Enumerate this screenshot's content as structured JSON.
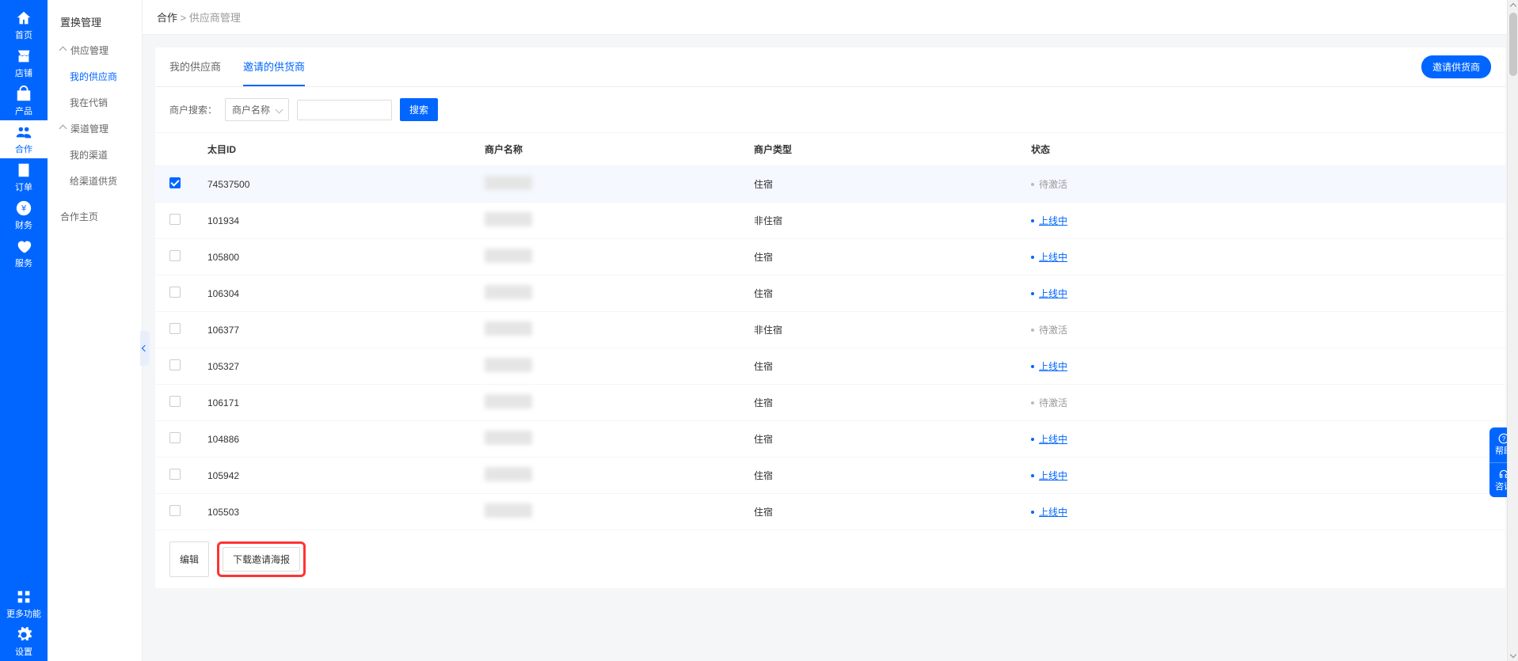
{
  "rail": {
    "items": [
      {
        "key": "home",
        "label": "首页"
      },
      {
        "key": "shop",
        "label": "店铺"
      },
      {
        "key": "product",
        "label": "产品"
      },
      {
        "key": "coop",
        "label": "合作",
        "active": true
      },
      {
        "key": "order",
        "label": "订单"
      },
      {
        "key": "finance",
        "label": "财务"
      },
      {
        "key": "service",
        "label": "服务"
      }
    ],
    "more_label": "更多功能",
    "settings_label": "设置"
  },
  "subnav": {
    "title": "置换管理",
    "groups": [
      {
        "label": "供应管理",
        "items": [
          {
            "label": "我的供应商",
            "active": true
          },
          {
            "label": "我在代销"
          }
        ]
      },
      {
        "label": "渠道管理",
        "items": [
          {
            "label": "我的渠道"
          },
          {
            "label": "给渠道供货"
          }
        ]
      }
    ],
    "standalone": {
      "label": "合作主页"
    }
  },
  "crumb": {
    "root": "合作",
    "sep": ">",
    "current": "供应商管理"
  },
  "tabs": {
    "items": [
      {
        "label": "我的供应商"
      },
      {
        "label": "邀请的供货商",
        "active": true
      }
    ],
    "invite_btn": "邀请供货商"
  },
  "filters": {
    "merchant_search_label": "商户搜索：",
    "select_value": "商户名称",
    "search_btn": "搜索"
  },
  "table": {
    "headers": {
      "id": "太目ID",
      "name": "商户名称",
      "type": "商户类型",
      "status": "状态"
    },
    "rows": [
      {
        "id": "74537500",
        "type": "住宿",
        "status": "pending",
        "status_text": "待激活",
        "checked": true
      },
      {
        "id": "101934",
        "type": "非住宿",
        "status": "online",
        "status_text": "上线中"
      },
      {
        "id": "105800",
        "type": "住宿",
        "status": "online",
        "status_text": "上线中"
      },
      {
        "id": "106304",
        "type": "住宿",
        "status": "online",
        "status_text": "上线中"
      },
      {
        "id": "106377",
        "type": "非住宿",
        "status": "pending",
        "status_text": "待激活"
      },
      {
        "id": "105327",
        "type": "住宿",
        "status": "online",
        "status_text": "上线中"
      },
      {
        "id": "106171",
        "type": "住宿",
        "status": "pending",
        "status_text": "待激活"
      },
      {
        "id": "104886",
        "type": "住宿",
        "status": "online",
        "status_text": "上线中"
      },
      {
        "id": "105942",
        "type": "住宿",
        "status": "online",
        "status_text": "上线中"
      },
      {
        "id": "105503",
        "type": "住宿",
        "status": "online",
        "status_text": "上线中"
      }
    ]
  },
  "actions": {
    "edit": "编辑",
    "download_poster": "下载邀请海报"
  },
  "float": {
    "help": "帮助",
    "consult": "咨询"
  }
}
